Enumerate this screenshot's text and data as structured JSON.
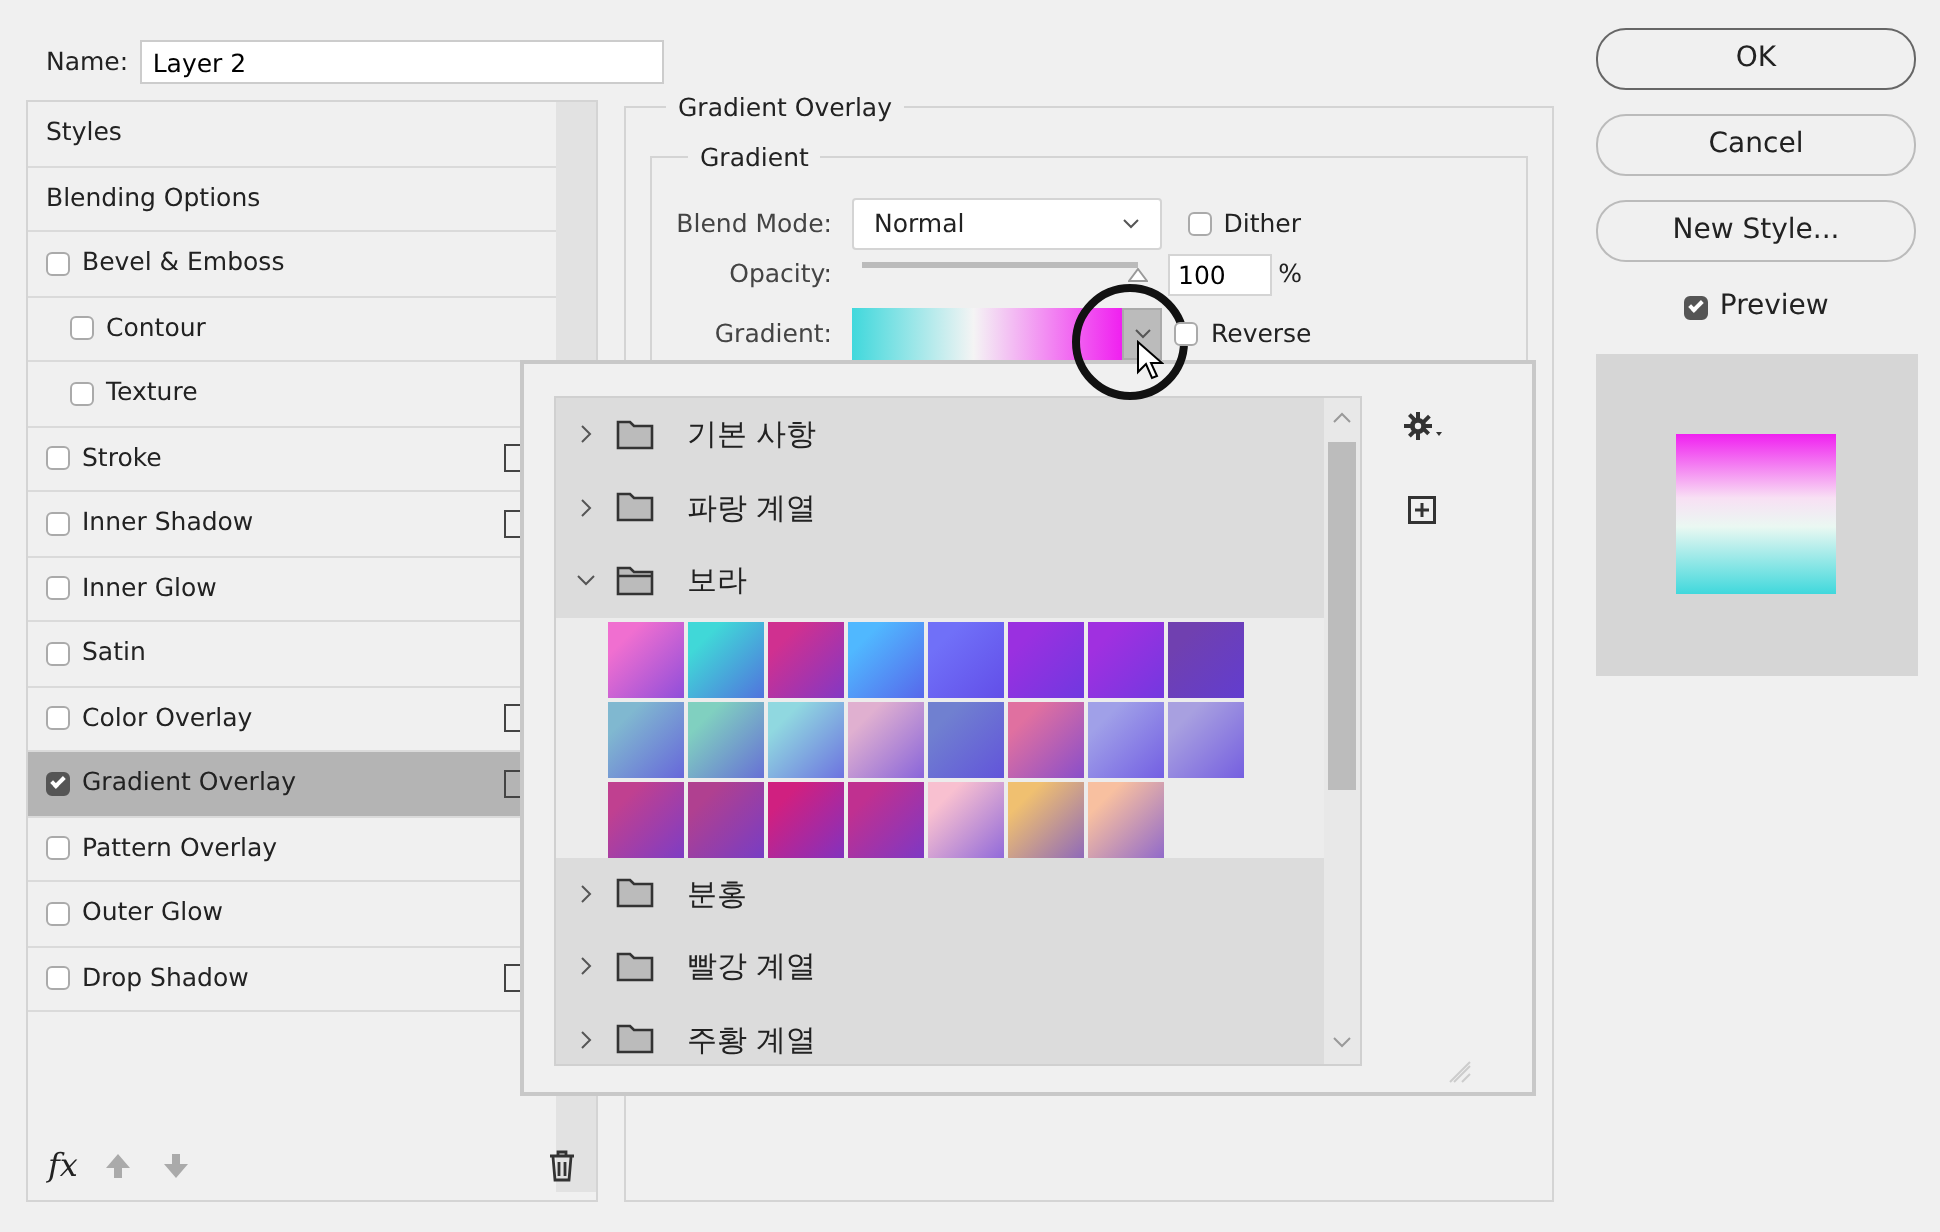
{
  "name_field": {
    "label": "Name:",
    "value": "Layer 2"
  },
  "styles_list": {
    "items": [
      {
        "label": "Styles",
        "kind": "header",
        "selected": false
      },
      {
        "label": "Blending Options",
        "kind": "header",
        "selected": false
      },
      {
        "label": "Bevel & Emboss",
        "kind": "check",
        "checked": false,
        "selected": false,
        "add_button": false
      },
      {
        "label": "Contour",
        "kind": "subcheck",
        "checked": false,
        "selected": false,
        "add_button": false
      },
      {
        "label": "Texture",
        "kind": "subcheck",
        "checked": false,
        "selected": false,
        "add_button": false
      },
      {
        "label": "Stroke",
        "kind": "check",
        "checked": false,
        "selected": false,
        "add_button": true
      },
      {
        "label": "Inner Shadow",
        "kind": "check",
        "checked": false,
        "selected": false,
        "add_button": true
      },
      {
        "label": "Inner Glow",
        "kind": "check",
        "checked": false,
        "selected": false,
        "add_button": false
      },
      {
        "label": "Satin",
        "kind": "check",
        "checked": false,
        "selected": false,
        "add_button": false
      },
      {
        "label": "Color Overlay",
        "kind": "check",
        "checked": false,
        "selected": false,
        "add_button": true
      },
      {
        "label": "Gradient Overlay",
        "kind": "check",
        "checked": true,
        "selected": true,
        "add_button": true
      },
      {
        "label": "Pattern Overlay",
        "kind": "check",
        "checked": false,
        "selected": false,
        "add_button": false
      },
      {
        "label": "Outer Glow",
        "kind": "check",
        "checked": false,
        "selected": false,
        "add_button": false
      },
      {
        "label": "Drop Shadow",
        "kind": "check",
        "checked": false,
        "selected": false,
        "add_button": true
      }
    ],
    "fx_label": "fx"
  },
  "gradient_overlay": {
    "title": "Gradient Overlay",
    "group": {
      "title": "Gradient",
      "blend_mode": {
        "label": "Blend Mode:",
        "value": "Normal"
      },
      "dither": {
        "label": "Dither",
        "checked": false
      },
      "opacity": {
        "label": "Opacity:",
        "level": 1.0,
        "value": "100",
        "unit": "%"
      },
      "gradient": {
        "label": "Gradient:"
      },
      "reverse": {
        "label": "Reverse",
        "checked": false
      }
    }
  },
  "buttons": [
    {
      "label": "OK",
      "default": true
    },
    {
      "label": "Cancel",
      "default": false
    },
    {
      "label": "New Style...",
      "default": false
    }
  ],
  "preview": {
    "label": "Preview",
    "checked": true
  },
  "gradient_picker": {
    "folders": [
      {
        "label": "기본 사항",
        "expanded": false
      },
      {
        "label": "파랑 계열",
        "expanded": false
      },
      {
        "label": "보라",
        "expanded": true,
        "swatches": [
          {
            "color": "#f06fd0"
          },
          {
            "color": "#40d8d8"
          },
          {
            "color": "#d03090"
          },
          {
            "color": "#50b8ff"
          },
          {
            "color": "#7070f8"
          },
          {
            "color": "#9a30e0"
          },
          {
            "color": "#a030e0"
          },
          {
            "color": "#7040b0"
          },
          {
            "color": "#80b8d0"
          },
          {
            "color": "#80d0c0"
          },
          {
            "color": "#90d8e0"
          },
          {
            "color": "#e0b0d0"
          },
          {
            "color": "#7080d0"
          },
          {
            "color": "#e070a0"
          },
          {
            "color": "#a0a0e8"
          },
          {
            "color": "#a8a0e0"
          },
          {
            "color": "#c04090"
          },
          {
            "color": "#b04090"
          },
          {
            "color": "#d02080"
          },
          {
            "color": "#c03090"
          },
          {
            "color": "#f8c0d0"
          },
          {
            "color": "#f0c070"
          },
          {
            "color": "#f8c0a0"
          }
        ]
      },
      {
        "label": "분홍",
        "expanded": false
      },
      {
        "label": "빨강 계열",
        "expanded": false
      },
      {
        "label": "주황 계열",
        "expanded": false
      }
    ]
  }
}
